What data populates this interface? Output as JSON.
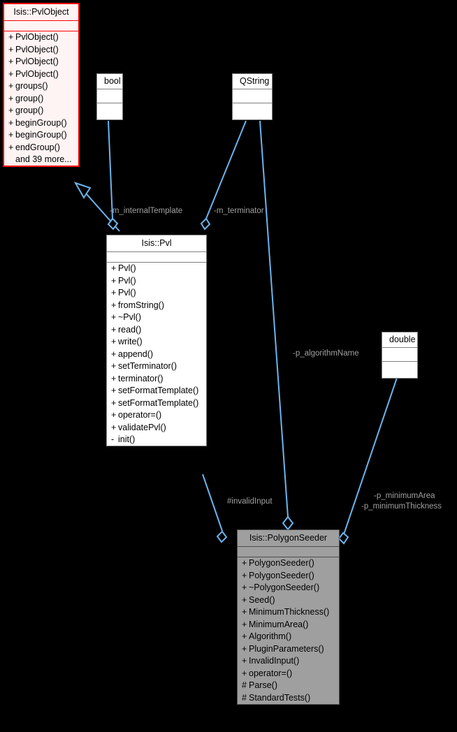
{
  "diagram": {
    "type": "uml-class-collaboration-diagram",
    "background_color": "#000000",
    "edge_color": "#6cb4ee",
    "label_color": "#a0a0a0"
  },
  "nodes": [
    {
      "id": "pvlobject",
      "name": "Isis::PvlObject",
      "style": "root-highlight",
      "border_color": "#ff0000",
      "fill_color": "#fff4f4",
      "attributes": [],
      "operations": [
        {
          "visibility": "+",
          "label": "PvlObject()"
        },
        {
          "visibility": "+",
          "label": "PvlObject()"
        },
        {
          "visibility": "+",
          "label": "PvlObject()"
        },
        {
          "visibility": "+",
          "label": "PvlObject()"
        },
        {
          "visibility": "+",
          "label": "groups()"
        },
        {
          "visibility": "+",
          "label": "group()"
        },
        {
          "visibility": "+",
          "label": "group()"
        },
        {
          "visibility": "+",
          "label": "beginGroup()"
        },
        {
          "visibility": "+",
          "label": "beginGroup()"
        },
        {
          "visibility": "+",
          "label": "endGroup()"
        },
        {
          "visibility": "",
          "label": "and 39 more..."
        }
      ]
    },
    {
      "id": "bool",
      "name": "bool",
      "style": "type",
      "fill_color": "#ffffff",
      "attributes": [],
      "operations": []
    },
    {
      "id": "qstring",
      "name": "QString",
      "style": "type",
      "fill_color": "#ffffff",
      "attributes": [],
      "operations": []
    },
    {
      "id": "double",
      "name": "double",
      "style": "type",
      "fill_color": "#ffffff",
      "attributes": [],
      "operations": []
    },
    {
      "id": "pvl",
      "name": "Isis::Pvl",
      "style": "plain",
      "fill_color": "#ffffff",
      "attributes": [],
      "operations": [
        {
          "visibility": "+",
          "label": "Pvl()"
        },
        {
          "visibility": "+",
          "label": "Pvl()"
        },
        {
          "visibility": "+",
          "label": "Pvl()"
        },
        {
          "visibility": "+",
          "label": "fromString()"
        },
        {
          "visibility": "+",
          "label": "~Pvl()"
        },
        {
          "visibility": "+",
          "label": "read()"
        },
        {
          "visibility": "+",
          "label": "write()"
        },
        {
          "visibility": "+",
          "label": "append()"
        },
        {
          "visibility": "+",
          "label": "setTerminator()"
        },
        {
          "visibility": "+",
          "label": "terminator()"
        },
        {
          "visibility": "+",
          "label": "setFormatTemplate()"
        },
        {
          "visibility": "+",
          "label": "setFormatTemplate()"
        },
        {
          "visibility": "+",
          "label": "operator=()"
        },
        {
          "visibility": "+",
          "label": "validatePvl()"
        },
        {
          "visibility": "-",
          "label": "init()"
        }
      ]
    },
    {
      "id": "polygonseeder",
      "name": "Isis::PolygonSeeder",
      "style": "focus",
      "fill_color": "#9f9f9f",
      "attributes": [],
      "operations": [
        {
          "visibility": "+",
          "label": "PolygonSeeder()"
        },
        {
          "visibility": "+",
          "label": "PolygonSeeder()"
        },
        {
          "visibility": "+",
          "label": "~PolygonSeeder()"
        },
        {
          "visibility": "+",
          "label": "Seed()"
        },
        {
          "visibility": "+",
          "label": "MinimumThickness()"
        },
        {
          "visibility": "+",
          "label": "MinimumArea()"
        },
        {
          "visibility": "+",
          "label": "Algorithm()"
        },
        {
          "visibility": "+",
          "label": "PluginParameters()"
        },
        {
          "visibility": "+",
          "label": "InvalidInput()"
        },
        {
          "visibility": "+",
          "label": "operator=()"
        },
        {
          "visibility": "#",
          "label": "Parse()"
        },
        {
          "visibility": "#",
          "label": "StandardTests()"
        }
      ]
    }
  ],
  "edges": [
    {
      "id": "pvl-inherits-pvlobject",
      "from": "pvl",
      "to": "pvlobject",
      "relation": "inheritance",
      "arrow": "hollow-triangle",
      "label": ""
    },
    {
      "id": "bool-to-pvl",
      "from": "bool",
      "to": "pvl",
      "relation": "aggregation",
      "arrow": "hollow-diamond",
      "label": "-m_internalTemplate"
    },
    {
      "id": "qstring-to-pvl",
      "from": "qstring",
      "to": "pvl",
      "relation": "aggregation",
      "arrow": "hollow-diamond",
      "label": "-m_terminator"
    },
    {
      "id": "qstring-to-polygonseeder",
      "from": "qstring",
      "to": "polygonseeder",
      "relation": "aggregation",
      "arrow": "hollow-diamond",
      "label": "-p_algorithmName"
    },
    {
      "id": "pvl-to-polygonseeder",
      "from": "pvl",
      "to": "polygonseeder",
      "relation": "aggregation",
      "arrow": "hollow-diamond",
      "label": "#invalidInput"
    },
    {
      "id": "double-to-polygonseeder",
      "from": "double",
      "to": "polygonseeder",
      "relation": "aggregation",
      "arrow": "hollow-diamond",
      "label": "-p_minimumArea\n-p_minimumThickness"
    }
  ],
  "labels": {
    "internal_template": "-m_internalTemplate",
    "terminator": "-m_terminator",
    "algorithm_name": "-p_algorithmName",
    "invalid_input": "#invalidInput",
    "minimum_area": "-p_minimumArea",
    "minimum_thickness": "-p_minimumThickness"
  }
}
